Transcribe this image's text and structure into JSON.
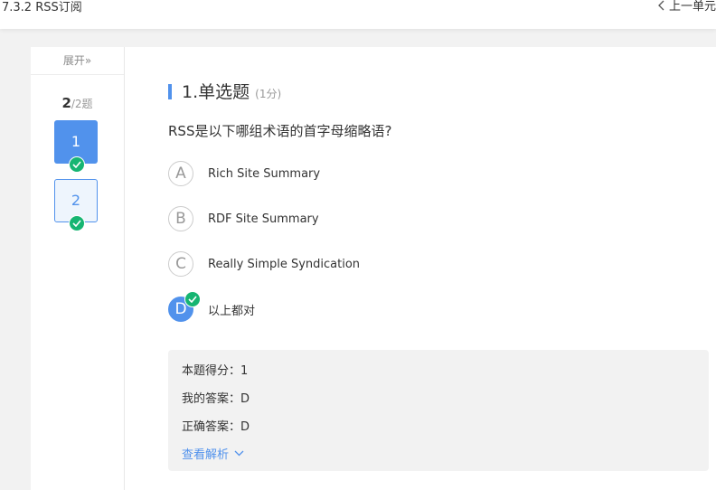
{
  "topbar": {
    "chapter_title": "7.3.2 RSS订阅",
    "prev_unit": "上一单元"
  },
  "sidebar": {
    "expand_label": "展开»",
    "current_index": "2",
    "total_suffix": "/2题",
    "questions": [
      {
        "number": "1",
        "answered": true,
        "current": true
      },
      {
        "number": "2",
        "answered": true,
        "current": false
      }
    ]
  },
  "question": {
    "type_title": "1.单选题",
    "score": "(1分)",
    "stem": "RSS是以下哪组术语的首字母缩略语?",
    "options": [
      {
        "letter": "A",
        "text": "Rich Site Summary"
      },
      {
        "letter": "B",
        "text": "RDF Site Summary"
      },
      {
        "letter": "C",
        "text": "Really Simple Syndication"
      },
      {
        "letter": "D",
        "text": "以上都对",
        "selected": true
      }
    ]
  },
  "result": {
    "score_line": "本题得分：1",
    "my_answer": "我的答案：D",
    "correct_answer": "正确答案：D",
    "view_analysis": "查看解析"
  },
  "colors": {
    "accent": "#5192ec",
    "success": "#16b572"
  }
}
